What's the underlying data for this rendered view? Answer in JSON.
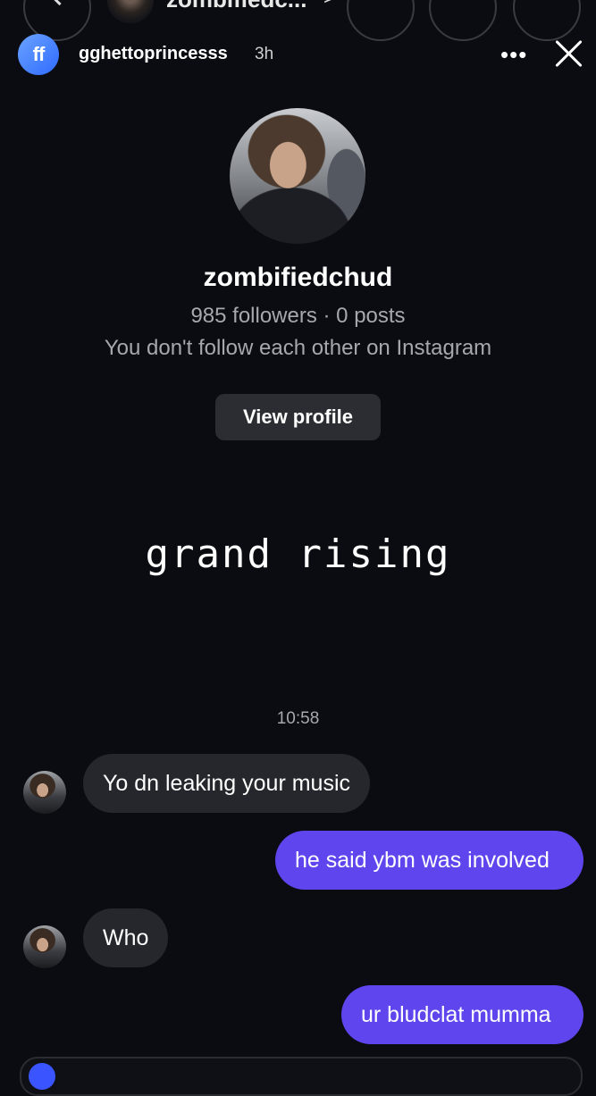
{
  "background_header": {
    "title": "zombifiedc...",
    "chevron": ">"
  },
  "story": {
    "logo_text": "ff",
    "username": "gghettoprincesss",
    "time": "3h",
    "more": "•••"
  },
  "profile": {
    "username": "zombifiedchud",
    "stats": "985 followers · 0 posts",
    "follow_status": "You don't follow each other on Instagram",
    "view_profile_label": "View profile"
  },
  "caption": "grand rising",
  "chat": {
    "timestamp": "10:58",
    "messages": [
      {
        "direction": "in",
        "text": "Yo dn leaking your music"
      },
      {
        "direction": "out",
        "text": "he said ybm was involved"
      },
      {
        "direction": "in",
        "text": "Who"
      },
      {
        "direction": "out",
        "text": "ur bludclat mumma"
      }
    ]
  },
  "colors": {
    "background": "#0b0c11",
    "incoming_bubble": "#26272c",
    "outgoing_bubble": "#5f45ee",
    "logo": "#2f6bff"
  }
}
